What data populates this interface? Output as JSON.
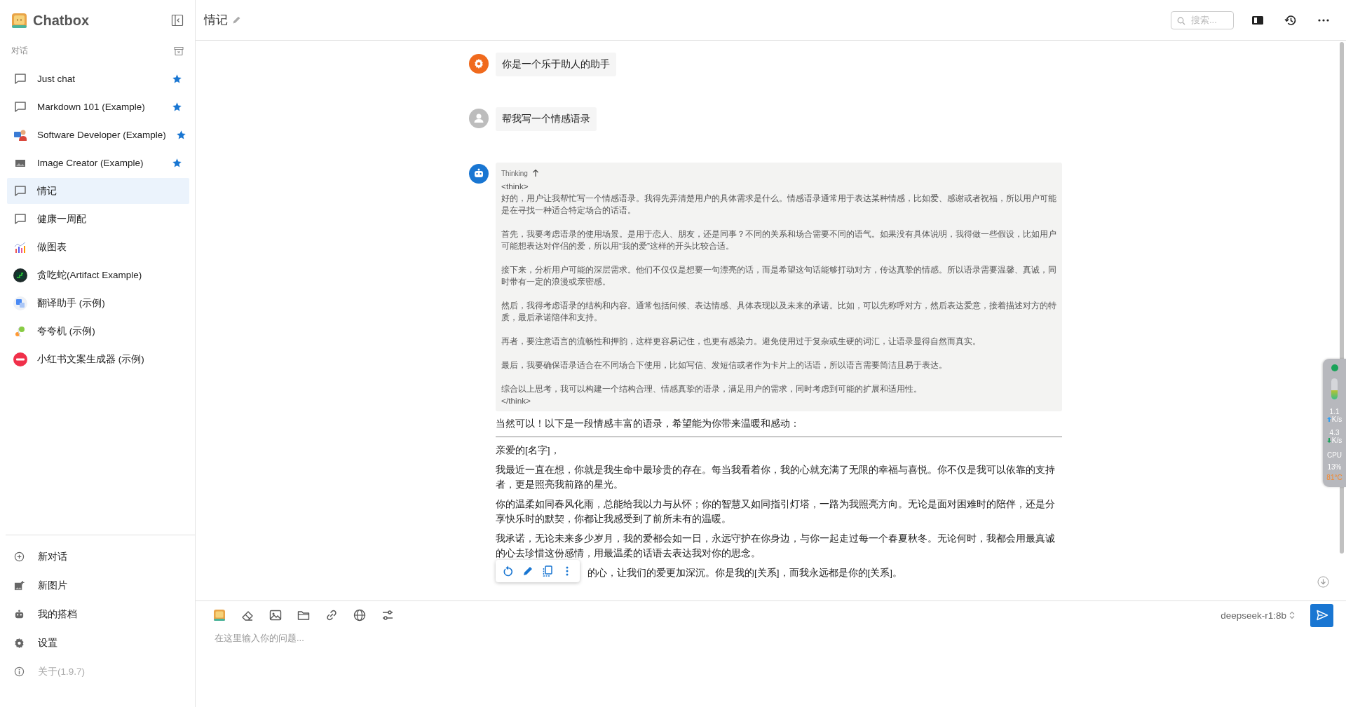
{
  "app": {
    "name": "Chatbox"
  },
  "sidebar": {
    "section_label": "对话",
    "sessions": [
      {
        "name": "Just chat",
        "kind": "chat",
        "starred": true,
        "selected": false
      },
      {
        "name": "Markdown 101 (Example)",
        "kind": "chat",
        "starred": true,
        "selected": false
      },
      {
        "name": "Software Developer (Example)",
        "kind": "developer",
        "starred": true,
        "selected": false
      },
      {
        "name": "Image Creator (Example)",
        "kind": "image",
        "starred": true,
        "selected": false
      },
      {
        "name": "情记",
        "kind": "chat",
        "starred": false,
        "selected": true
      },
      {
        "name": "健康一周配",
        "kind": "chat",
        "starred": false,
        "selected": false
      },
      {
        "name": "做图表",
        "kind": "chart",
        "starred": false,
        "selected": false
      },
      {
        "name": "贪吃蛇(Artifact Example)",
        "kind": "snake",
        "starred": false,
        "selected": false
      },
      {
        "name": "翻译助手 (示例)",
        "kind": "translate",
        "starred": false,
        "selected": false
      },
      {
        "name": "夸夸机 (示例)",
        "kind": "praise",
        "starred": false,
        "selected": false
      },
      {
        "name": "小红书文案生成器 (示例)",
        "kind": "red",
        "starred": false,
        "selected": false
      }
    ],
    "actions": [
      {
        "label": "新对话",
        "kind": "new-chat",
        "disabled": false
      },
      {
        "label": "新图片",
        "kind": "new-image",
        "disabled": false
      },
      {
        "label": "我的搭档",
        "kind": "copilots",
        "disabled": false
      },
      {
        "label": "设置",
        "kind": "settings",
        "disabled": false
      },
      {
        "label": "关于(1.9.7)",
        "kind": "about",
        "disabled": true
      }
    ]
  },
  "header": {
    "title": "情记",
    "search": {
      "placeholder": "搜索..."
    }
  },
  "messages": [
    {
      "kind": "system",
      "text": "你是一个乐于助人的助手"
    },
    {
      "kind": "user",
      "text": "帮我写一个情感语录"
    },
    {
      "kind": "assistant",
      "thinking": {
        "label": "Thinking",
        "expanded": true,
        "open_tag": "<think>",
        "close_tag": "</think>",
        "paragraphs": [
          "好的，用户让我帮忙写一个情感语录。我得先弄清楚用户的具体需求是什么。情感语录通常用于表达某种情感，比如爱、感谢或者祝福，所以用户可能是在寻找一种适合特定场合的话语。",
          "首先，我要考虑语录的使用场景。是用于恋人、朋友，还是同事？不同的关系和场合需要不同的语气。如果没有具体说明，我得做一些假设，比如用户可能想表达对伴侣的爱，所以用“我的爱”这样的开头比较合适。",
          "接下来，分析用户可能的深层需求。他们不仅仅是想要一句漂亮的话，而是希望这句话能够打动对方，传达真挚的情感。所以语录需要温馨、真诚，同时带有一定的浪漫或亲密感。",
          "然后，我得考虑语录的结构和内容。通常包括问候、表达情感、具体表现以及未来的承诺。比如，可以先称呼对方，然后表达爱意，接着描述对方的特质，最后承诺陪伴和支持。",
          "再者，要注意语言的流畅性和押韵，这样更容易记住，也更有感染力。避免使用过于复杂或生硬的词汇，让语录显得自然而真实。",
          "最后，我要确保语录适合在不同场合下使用，比如写信、发短信或者作为卡片上的话语，所以语言需要简洁且易于表达。",
          "综合以上思考，我可以构建一个结构合理、情感真挚的语录，满足用户的需求，同时考虑到可能的扩展和适用性。"
        ]
      },
      "intro": "当然可以！以下是一段情感丰富的语录，希望能为你带来温暖和感动：",
      "paragraphs": [
        "亲爱的[名字]，",
        "我最近一直在想，你就是我生命中最珍贵的存在。每当我看着你，我的心就充满了无限的幸福与喜悦。你不仅是我可以依靠的支持者，更是照亮我前路的星光。",
        "你的温柔如同春风化雨，总能给我以力与从怀；你的智慧又如同指引灯塔，一路为我照亮方向。无论是面对困难时的陪伴，还是分享快乐时的默契，你都让我感受到了前所未有的温暖。",
        "我承诺，无论未来多少岁月，我的爱都会如一日，永远守护在你身边，与你一起走过每一个春夏秋冬。无论何时，我都会用最真诚的心去珍惜这份感情，用最温柔的话语去表达我对你的思念。",
        "的心，让我们的爱更加深沉。你是我的[关系]，而我永远都是你的[关系]。"
      ]
    }
  ],
  "composer": {
    "placeholder": "在这里输入你的问题...",
    "model": "deepseek-r1:8b"
  },
  "monitor": {
    "upload": "1.1",
    "upload_unit": "K/s",
    "download": "4.3",
    "download_unit": "K/s",
    "cpu_label": "CPU",
    "cpu": "13%",
    "temperature": "81°C",
    "level": 0.45
  }
}
